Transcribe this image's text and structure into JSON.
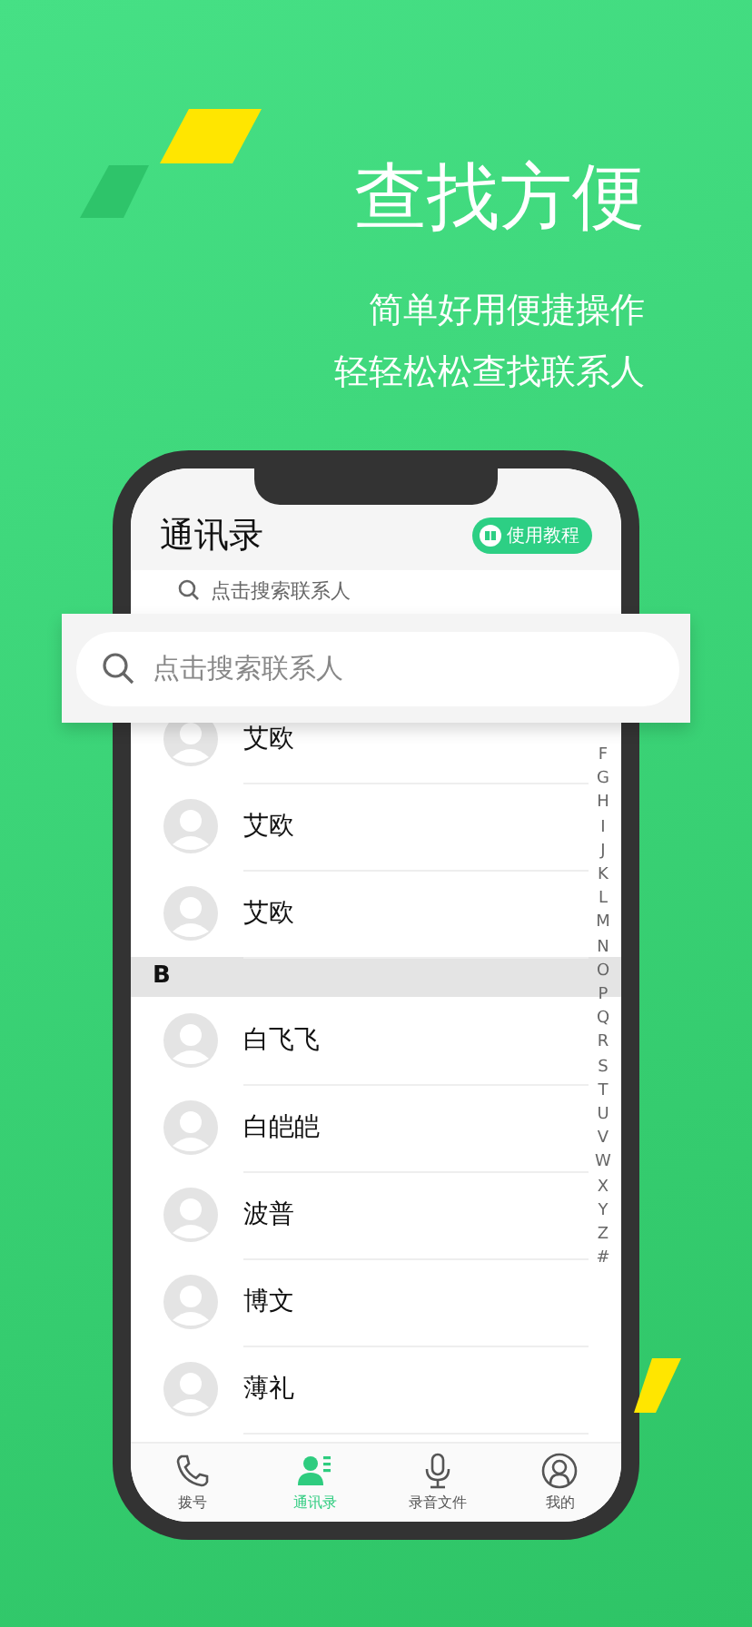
{
  "headline": "查找方便",
  "subtitle_lines": [
    "简单好用便捷操作",
    "轻轻松松查找联系人"
  ],
  "app": {
    "title": "通讯录",
    "tutorial_button": "使用教程",
    "search": {
      "placeholder": "点击搜索联系人"
    },
    "list": [
      {
        "kind": "contact",
        "name": "艾欧"
      },
      {
        "kind": "contact",
        "name": "艾欧"
      },
      {
        "kind": "contact",
        "name": "艾欧"
      },
      {
        "kind": "section",
        "label": "B"
      },
      {
        "kind": "contact",
        "name": "白飞飞"
      },
      {
        "kind": "contact",
        "name": "白皑皑"
      },
      {
        "kind": "contact",
        "name": "波普"
      },
      {
        "kind": "contact",
        "name": "博文"
      },
      {
        "kind": "contact",
        "name": "薄礼"
      }
    ],
    "index_letters": [
      "F",
      "G",
      "H",
      "I",
      "J",
      "K",
      "L",
      "M",
      "N",
      "O",
      "P",
      "Q",
      "R",
      "S",
      "T",
      "U",
      "V",
      "W",
      "X",
      "Y",
      "Z",
      "#"
    ],
    "tabs": [
      {
        "kind": "dial",
        "label": "拨号",
        "selected": false
      },
      {
        "kind": "contacts",
        "label": "通讯录",
        "selected": true
      },
      {
        "kind": "recordings",
        "label": "录音文件",
        "selected": false
      },
      {
        "kind": "profile",
        "label": "我的",
        "selected": false
      }
    ]
  },
  "search_overlay": {
    "placeholder": "点击搜索联系人"
  }
}
